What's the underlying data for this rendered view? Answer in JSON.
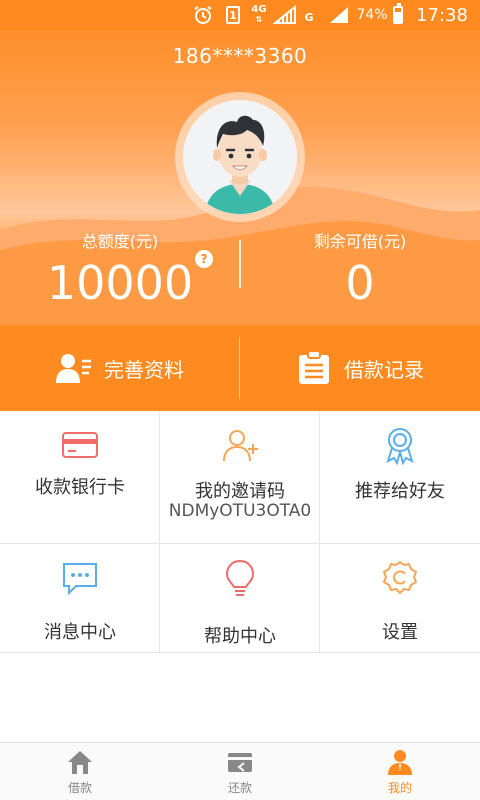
{
  "status_bar": {
    "sim": "1",
    "network_4g": "4G",
    "network_g": "G",
    "battery": "74%",
    "time": "17:38"
  },
  "profile": {
    "phone": "186****3360"
  },
  "stats": {
    "total_label": "总额度(元)",
    "total_value": "10000",
    "help_mark": "?",
    "remaining_label": "剩余可借(元)",
    "remaining_value": "0"
  },
  "actions": {
    "complete_profile": "完善资料",
    "loan_records": "借款记录"
  },
  "grid": {
    "bank_card": "收款银行卡",
    "invite_code_label": "我的邀请码",
    "invite_code_value": "NDMyOTU3OTA0",
    "recommend": "推荐给好友",
    "messages": "消息中心",
    "help": "帮助中心",
    "settings": "设置"
  },
  "tabs": [
    {
      "label": "借款",
      "icon": "house-icon"
    },
    {
      "label": "还款",
      "icon": "card-return-icon"
    },
    {
      "label": "我的",
      "icon": "person-icon",
      "active": true
    }
  ],
  "colors": {
    "brand": "#ff8a1f",
    "icon_red": "#f26b6b",
    "icon_orange": "#f4a556",
    "icon_blue": "#5aaee8"
  }
}
